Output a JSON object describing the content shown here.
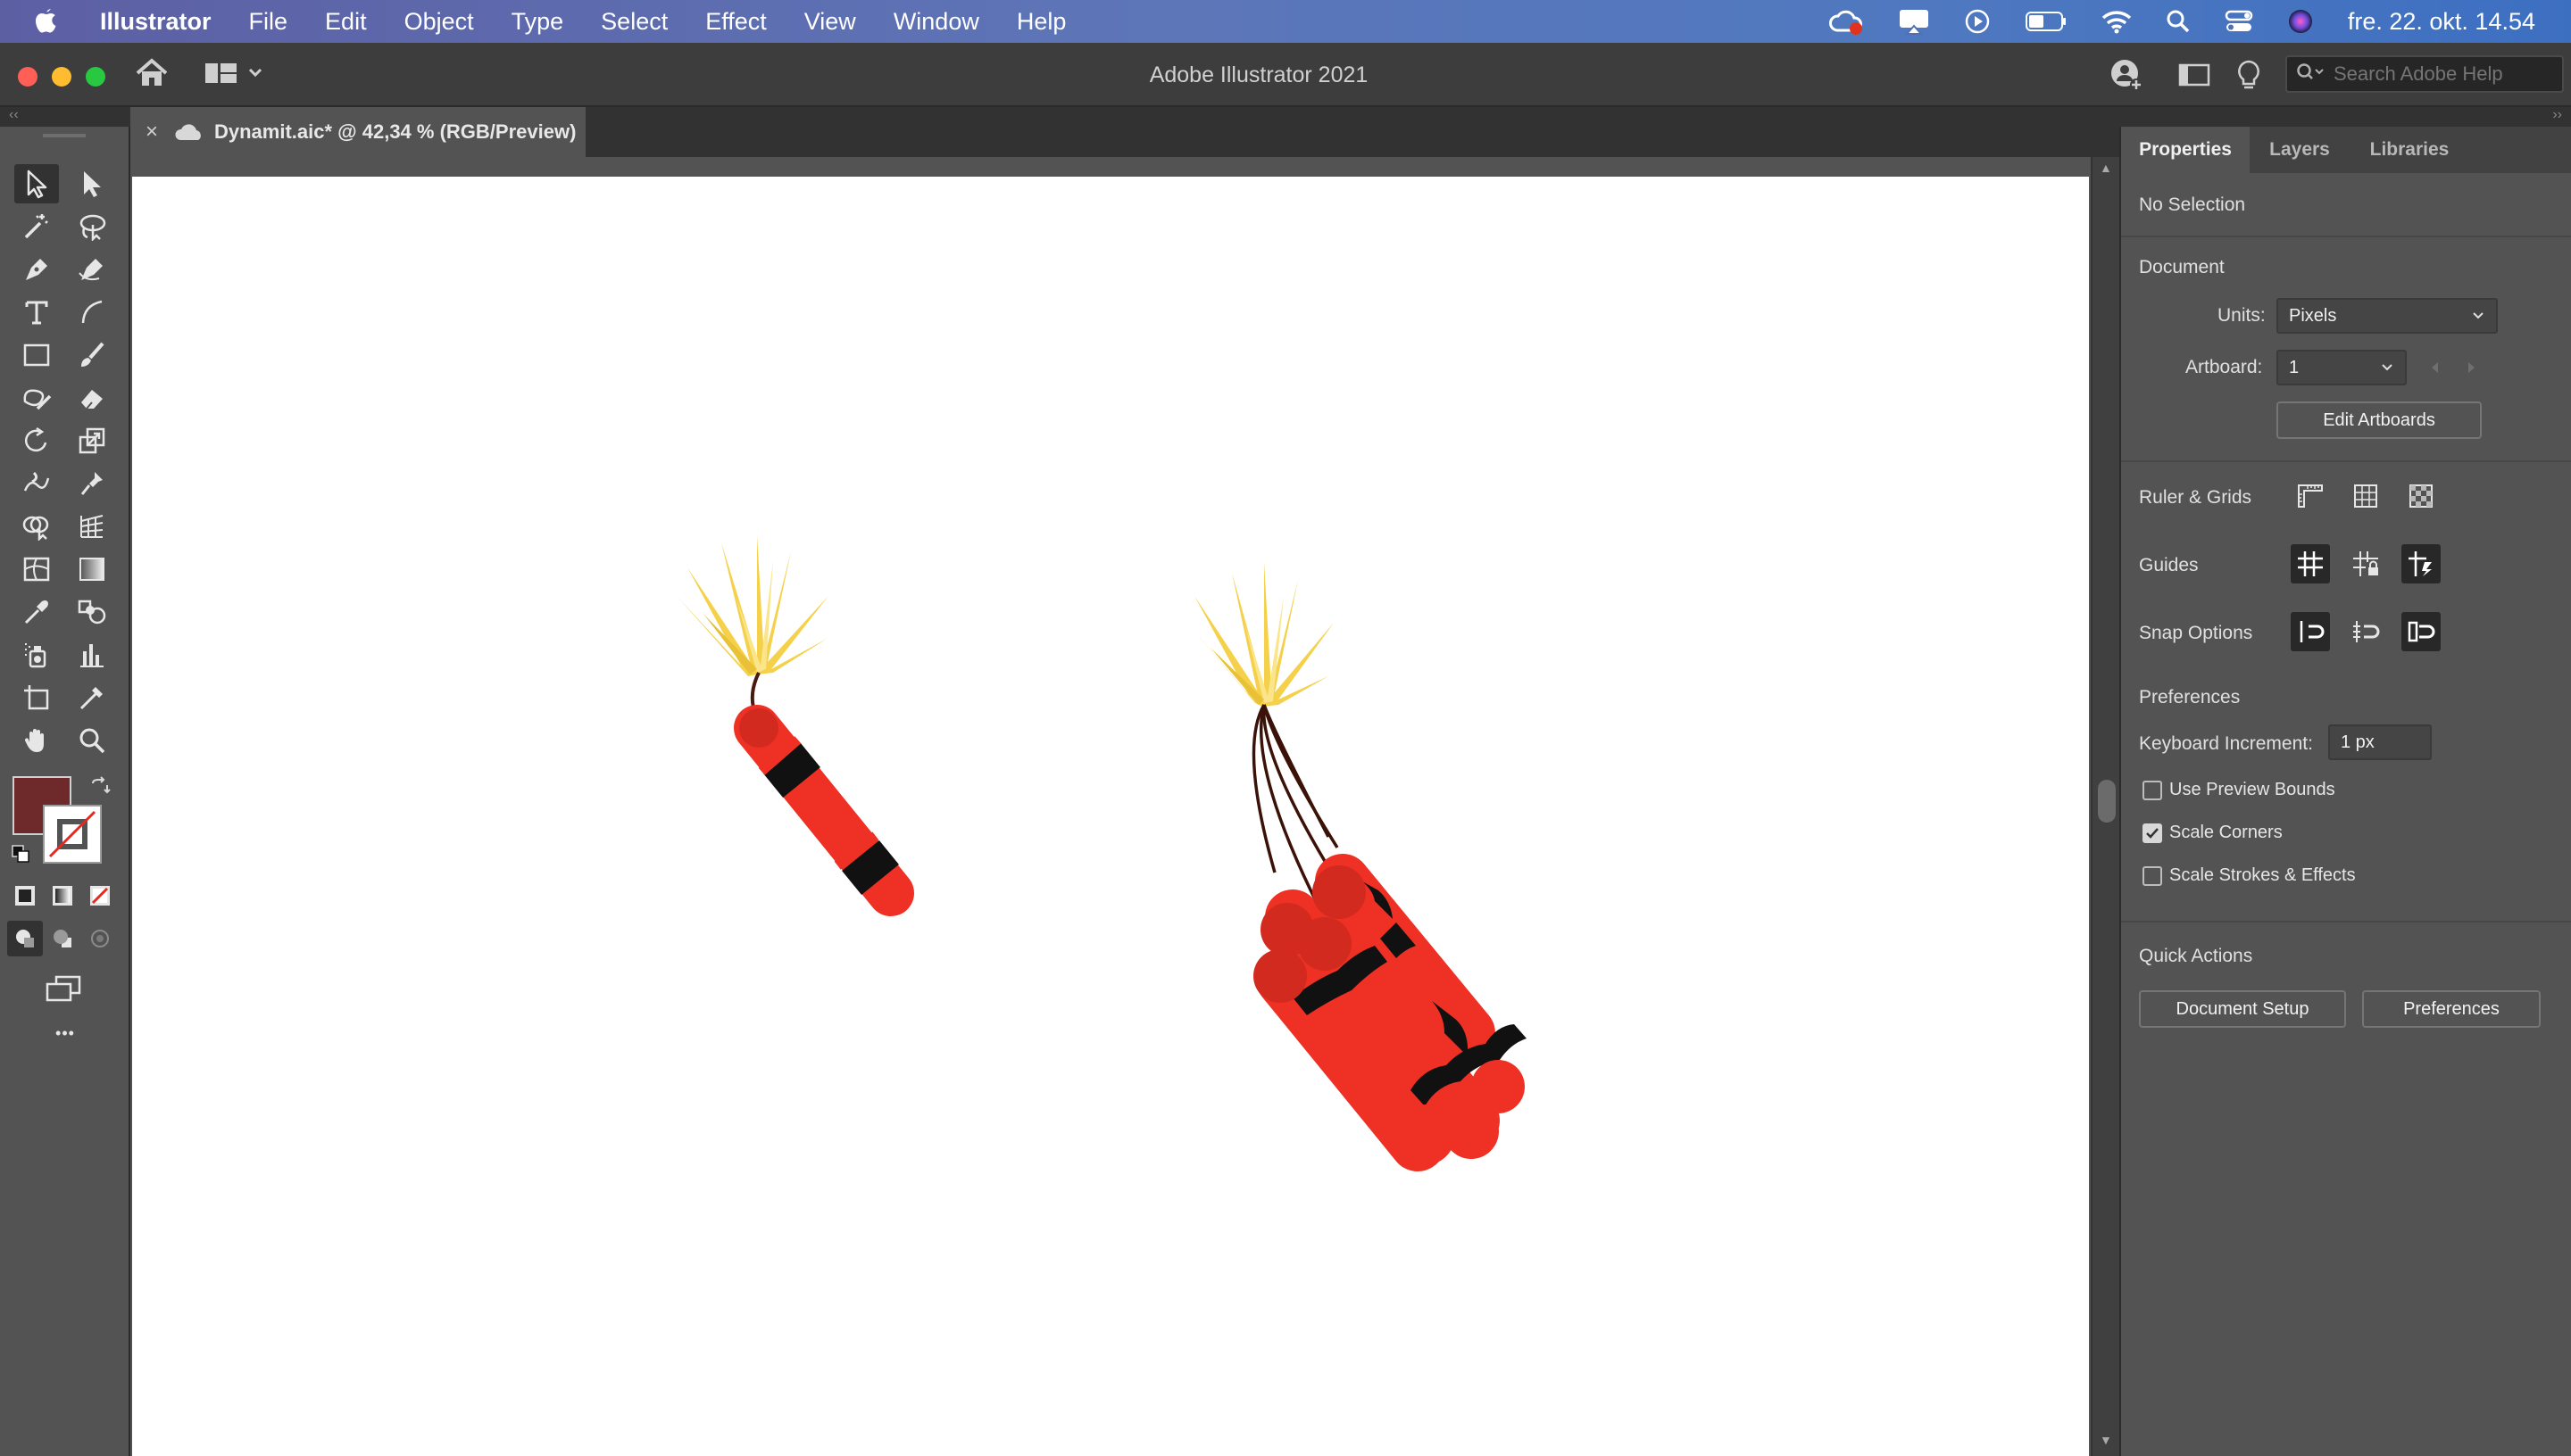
{
  "menubar": {
    "app_name": "Illustrator",
    "items": [
      "File",
      "Edit",
      "Object",
      "Type",
      "Select",
      "Effect",
      "View",
      "Window",
      "Help"
    ],
    "clock": "fre. 22. okt.  14.54",
    "status_icons": [
      "creative-cloud-icon",
      "airplay-icon",
      "play-icon",
      "battery-icon",
      "wifi-icon",
      "spotlight-search-icon",
      "control-center-icon",
      "siri-icon"
    ]
  },
  "titlebar": {
    "title": "Adobe Illustrator 2021",
    "search_placeholder": "Search Adobe Help"
  },
  "document": {
    "tab_title": "Dynamit.aic* @ 42,34 % (RGB/Preview)",
    "close_glyph": "×"
  },
  "toolbar": {
    "fill_color": "#6e2a2a",
    "stroke_color": "#ffffff",
    "more_glyph": "•••"
  },
  "panel": {
    "tabs": [
      "Properties",
      "Layers",
      "Libraries"
    ],
    "active_tab": "Properties",
    "selection_status": "No Selection",
    "document_header": "Document",
    "units_label": "Units:",
    "units_value": "Pixels",
    "artboard_label": "Artboard:",
    "artboard_value": "1",
    "edit_artboards": "Edit Artboards",
    "ruler_grids": "Ruler & Grids",
    "guides": "Guides",
    "snap_options": "Snap Options",
    "preferences_header": "Preferences",
    "keyboard_increment_label": "Keyboard Increment:",
    "keyboard_increment_value": "1 px",
    "checkboxes": [
      {
        "label": "Use Preview Bounds",
        "checked": false
      },
      {
        "label": "Scale Corners",
        "checked": true
      },
      {
        "label": "Scale Strokes & Effects",
        "checked": false
      }
    ],
    "quick_actions": "Quick Actions",
    "document_setup": "Document Setup",
    "preferences_button": "Preferences"
  },
  "artwork": {
    "dynamite_red": "#ee3124",
    "band_black": "#111111",
    "spark_yellow": "#f5d04a",
    "fuse_brown": "#4a1a0e"
  }
}
